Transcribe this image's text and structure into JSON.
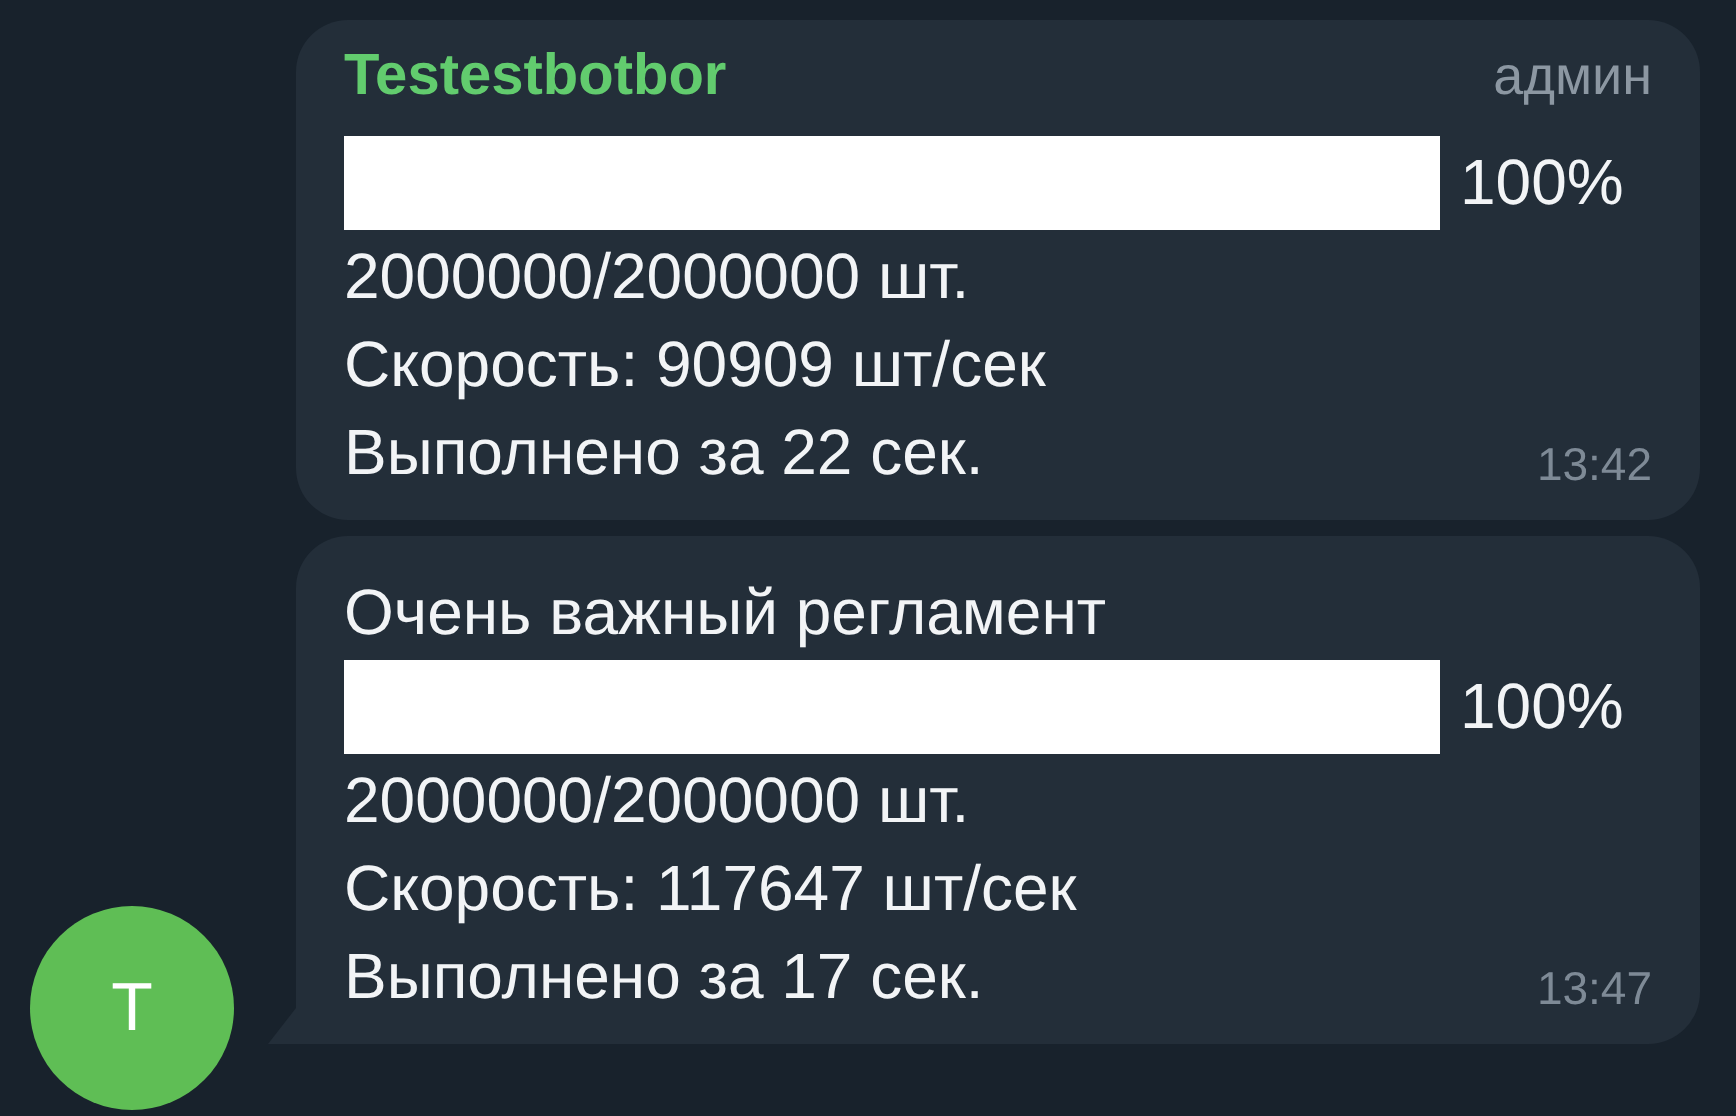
{
  "messages": [
    {
      "author": "Testestbotbor",
      "role": "админ",
      "progress": {
        "level": 1,
        "label": "100%"
      },
      "lines": [
        "2000000/2000000 шт.",
        "Скорость: 90909 шт/сек",
        "Выполнено за 22 сек."
      ],
      "time": "13:42",
      "tail": false
    },
    {
      "title": "Очень важный регламент",
      "progress": {
        "level": 1,
        "label": "100%"
      },
      "lines": [
        "2000000/2000000 шт.",
        "Скорость: 117647 шт/сек",
        "Выполнено за 17 сек."
      ],
      "time": "13:47",
      "tail": true
    }
  ],
  "avatar": {
    "letter": "T"
  }
}
